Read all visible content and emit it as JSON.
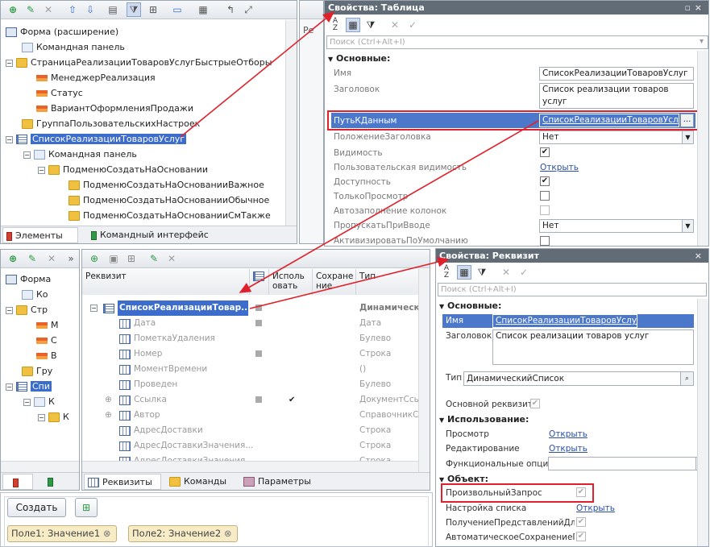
{
  "top_left_tree": {
    "items": [
      {
        "label": "Форма (расширение)"
      },
      {
        "label": "Командная панель"
      },
      {
        "label": "СтраницаРеализацииТоваровУслугБыстрыеОтборы"
      },
      {
        "label": "МенеджерРеализация"
      },
      {
        "label": "Статус"
      },
      {
        "label": "ВариантОформленияПродажи"
      },
      {
        "label": "ГруппаПользовательскихНастроек"
      },
      {
        "label": "СписокРеализацииТоваровУслуг"
      },
      {
        "label": "Командная панель"
      },
      {
        "label": "ПодменюСоздатьНаОсновании"
      },
      {
        "label": "ПодменюСоздатьНаОснованииВажное"
      },
      {
        "label": "ПодменюСоздатьНаОснованииОбычное"
      },
      {
        "label": "ПодменюСоздатьНаОснованииСмТакже"
      }
    ],
    "tabs": {
      "elements": "Элементы",
      "commands": "Командный интерфейс"
    }
  },
  "mid_strip": {
    "label": "Ре"
  },
  "props_table": {
    "title": "Свойства: Таблица",
    "search_placeholder": "Поиск (Ctrl+Alt+I)",
    "section": "Основные:",
    "rows": {
      "name_label": "Имя",
      "name_value": "СписокРеализацииТоваровУслуг",
      "title_label": "Заголовок",
      "title_value": "Список реализации товаров услуг",
      "path_label": "ПутьКДанным",
      "path_value": "СписокРеализацииТоваровУслуг",
      "title_pos_label": "ПоложениеЗаголовка",
      "title_pos_value": "Нет",
      "visible_label": "Видимость",
      "user_visible_label": "Пользовательская видимость",
      "user_visible_link": "Открыть",
      "enabled_label": "Доступность",
      "readonly_label": "ТолькоПросмотр",
      "autofill_label": "Автозаполнение колонок",
      "skip_label": "ПропускатьПриВводе",
      "skip_value": "Нет",
      "activate_label": "АктивизироватьПоУмолчанию"
    },
    "ellipsis": "..."
  },
  "bottom_left_tree": {
    "items": [
      "Форма",
      "Ко",
      "Стр",
      "М",
      "С",
      "В",
      "Гру",
      "Спи",
      "К",
      "К"
    ]
  },
  "attributes": {
    "columns": {
      "name": "Реквизит",
      "use": "Использ­овать",
      "save": "Сохране­ние",
      "type": "Тип"
    },
    "col_use_l1": "Исполь",
    "col_use_l2": "овать",
    "col_save_l1": "Сохране",
    "col_save_l2": "ние",
    "rows": [
      {
        "name": "СписокРеализацииТовар...",
        "type": "Динамическ"
      },
      {
        "name": "Дата",
        "type": "Дата"
      },
      {
        "name": "ПометкаУдаления",
        "type": "Булево"
      },
      {
        "name": "Номер",
        "type": "Строка"
      },
      {
        "name": "МоментВремени",
        "type": "()"
      },
      {
        "name": "Проведен",
        "type": "Булево"
      },
      {
        "name": "Ссылка",
        "type": "ДокументСсы"
      },
      {
        "name": "Автор",
        "type": "СправочникСс"
      },
      {
        "name": "АдресДоставки",
        "type": "Строка"
      },
      {
        "name": "АдресДоставкиЗначения...",
        "type": "Строка"
      },
      {
        "name": "АдресДоставкиЗначения...",
        "type": "Строка"
      }
    ],
    "tabs": {
      "attrs": "Реквизиты",
      "commands": "Команды",
      "params": "Параметры"
    }
  },
  "preview": {
    "create_button": "Создать",
    "chips": [
      "Поле1: Значение1",
      "Поле2: Значение2"
    ]
  },
  "props_attr": {
    "title": "Свойства: Реквизит",
    "search_placeholder": "Поиск (Ctrl+Alt+I)",
    "section_main": "Основные:",
    "name_label": "Имя",
    "name_value": "СписокРеализацииТоваровУслуг",
    "title_label": "Заголовок",
    "title_value": "Список реализации товаров услуг",
    "type_label": "Тип",
    "type_value": "ДинамическийСписок",
    "main_attr_label": "Основной реквизит",
    "section_use": "Использование:",
    "view_label": "Просмотр",
    "view_link": "Открыть",
    "edit_label": "Редактирование",
    "edit_link": "Открыть",
    "func_label": "Функциональные опции",
    "section_object": "Объект:",
    "custom_query_label": "ПроизвольныйЗапрос",
    "list_settings_label": "Настройка списка",
    "list_settings_link": "Открыть",
    "get_repr_label": "ПолучениеПредставленийДляН",
    "autosave_label": "АвтоматическоеСохранениеПо"
  },
  "colors": {
    "accent_red": "#e0202a",
    "selection": "#3d6dcc",
    "header": "#616c77"
  }
}
